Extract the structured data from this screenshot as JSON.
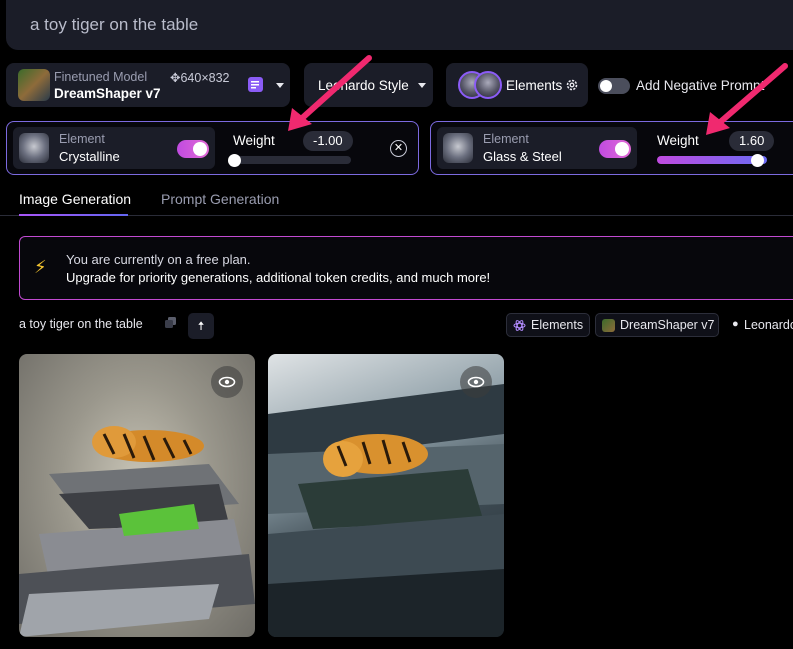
{
  "prompt": {
    "text": "a toy tiger on the table"
  },
  "model": {
    "caption": "Finetuned Model",
    "name": "DreamShaper v7",
    "dimensions": "✥640×832"
  },
  "style": {
    "label": "Leonardo Style"
  },
  "elements_button": {
    "label": "Elements"
  },
  "negative_prompt": {
    "label": "Add Negative Prompt",
    "enabled": false
  },
  "element_cards": [
    {
      "caption": "Element",
      "name": "Crystalline",
      "enabled": true,
      "weight_label": "Weight",
      "weight_value": "-1.00",
      "weight": -1.0
    },
    {
      "caption": "Element",
      "name": "Glass & Steel",
      "enabled": true,
      "weight_label": "Weight",
      "weight_value": "1.60",
      "weight": 1.6
    }
  ],
  "tabs": [
    {
      "label": "Image Generation",
      "active": true
    },
    {
      "label": "Prompt Generation",
      "active": false
    }
  ],
  "banner": {
    "line1": "You are currently on a free plan.",
    "line2": "Upgrade for priority generations, additional token credits, and much more!"
  },
  "generation": {
    "prompt": "a toy tiger on the table",
    "tags": [
      "Elements",
      "DreamShaper v7",
      "Leonardo"
    ]
  },
  "colors": {
    "accent": "#8b5cf6",
    "highlight": "#e11d74",
    "background": "#000000"
  }
}
